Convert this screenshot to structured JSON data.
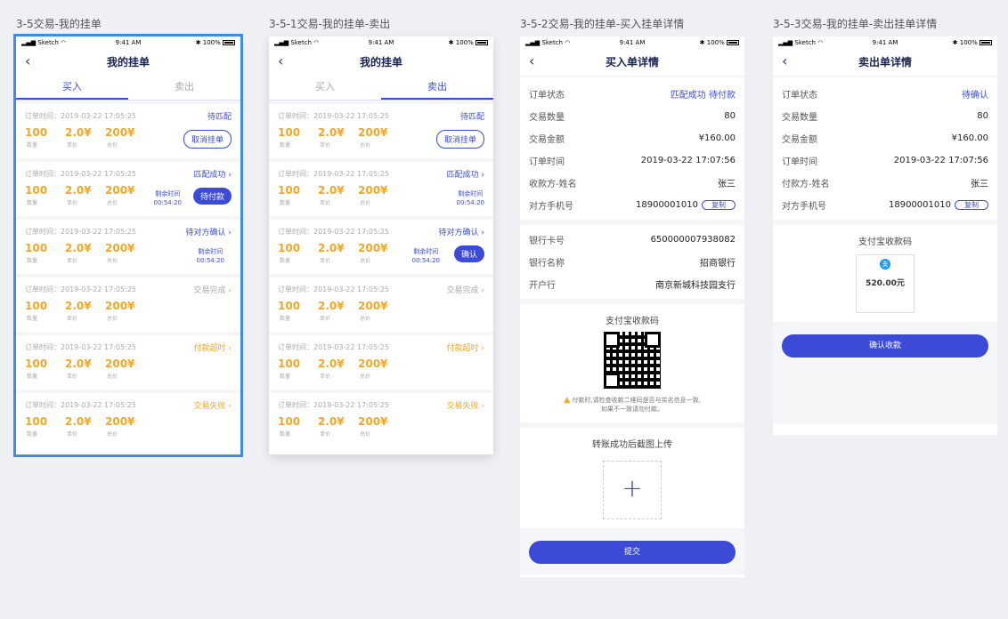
{
  "artboards": {
    "a1": "3-5交易-我的挂单",
    "a2": "3-5-1交易-我的挂单-卖出",
    "a3": "3-5-2交易-我的挂单-买入挂单详情",
    "a4": "3-5-3交易-我的挂单-卖出挂单详情"
  },
  "status_bar": {
    "carrier": "Sketch",
    "time": "9:41 AM",
    "battery": "100%"
  },
  "list": {
    "title": "我的挂单",
    "tab_buy": "买入",
    "tab_sell": "卖出",
    "time_label": "订单时间：2019-03-22 17:05:25",
    "qty": "100",
    "price": "2.0¥",
    "total": "200¥",
    "qty_label": "数量",
    "price_label": "单价",
    "total_label": "总价",
    "remain_label": "剩余时间",
    "remain_value": "00:54:20",
    "cancel_btn": "取消挂单",
    "pay_btn": "待付款",
    "confirm_btn": "确认",
    "statuses": {
      "s1": "待匹配",
      "s2": "匹配成功",
      "s3": "待对方确认",
      "s4": "交易完成",
      "s5": "付款超时",
      "s6": "交易失败"
    }
  },
  "buy_detail": {
    "title": "买入单详情",
    "rows": [
      {
        "k": "订单状态",
        "v": "匹配成功 待付款"
      },
      {
        "k": "交易数量",
        "v": "80"
      },
      {
        "k": "交易金额",
        "v": "¥160.00"
      },
      {
        "k": "订单时间",
        "v": "2019-03-22 17:07:56"
      },
      {
        "k": "收款方-姓名",
        "v": "张三"
      },
      {
        "k": "对方手机号",
        "v": "18900001010"
      }
    ],
    "copy": "复制",
    "bank_rows": [
      {
        "k": "银行卡号",
        "v": "650000007938082"
      },
      {
        "k": "银行名称",
        "v": "招商银行"
      },
      {
        "k": "开户行",
        "v": "南京新城科技园支行"
      }
    ],
    "qr_title": "支付宝收款码",
    "warn1": "付款时,请检查收款二维码是否与实名信息一致,",
    "warn2": "如果不一致请勿付款。",
    "upload_title": "转账成功后截图上传",
    "submit": "提交"
  },
  "sell_detail": {
    "title": "卖出单详情",
    "rows": [
      {
        "k": "订单状态",
        "v": "待确认"
      },
      {
        "k": "交易数量",
        "v": "80"
      },
      {
        "k": "交易金额",
        "v": "¥160.00"
      },
      {
        "k": "订单时间",
        "v": "2019-03-22 17:07:56"
      },
      {
        "k": "付款方-姓名",
        "v": "张三"
      },
      {
        "k": "对方手机号",
        "v": "18900001010"
      }
    ],
    "copy": "复制",
    "qr_title": "支付宝收款码",
    "alipay_amount": "520.00元",
    "confirm": "确认收款"
  },
  "colors": {
    "primary": "#3b4bd8",
    "orange": "#f5a623",
    "gray": "#aaaaaa"
  }
}
